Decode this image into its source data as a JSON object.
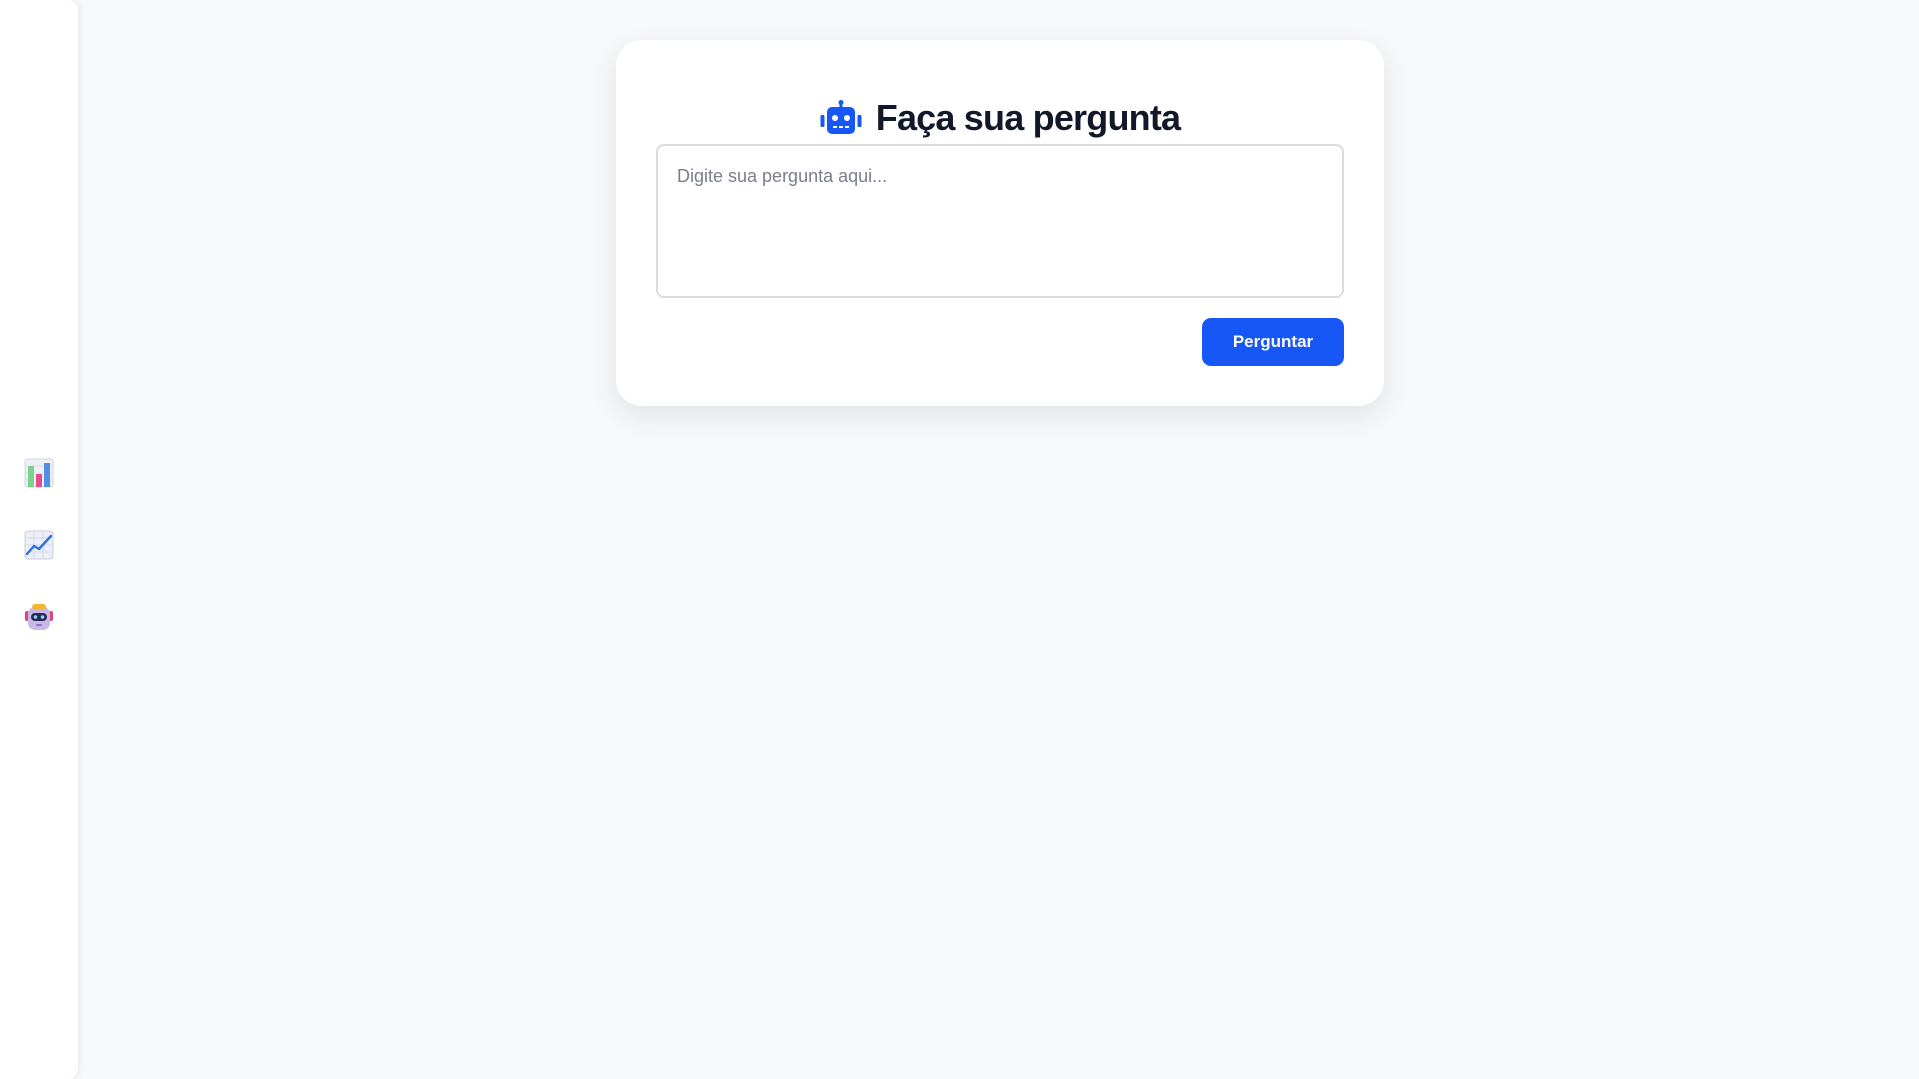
{
  "sidebar": {
    "items": [
      {
        "icon": "bar-chart-icon"
      },
      {
        "icon": "line-chart-icon"
      },
      {
        "icon": "robot-face-icon"
      }
    ]
  },
  "main": {
    "title": "Faça sua pergunta",
    "title_icon": "robot-icon",
    "question_placeholder": "Digite sua pergunta aqui...",
    "question_value": "",
    "submit_label": "Perguntar"
  },
  "colors": {
    "accent": "#1657f5",
    "title_text": "#111827",
    "background": "#f7f8fa"
  }
}
